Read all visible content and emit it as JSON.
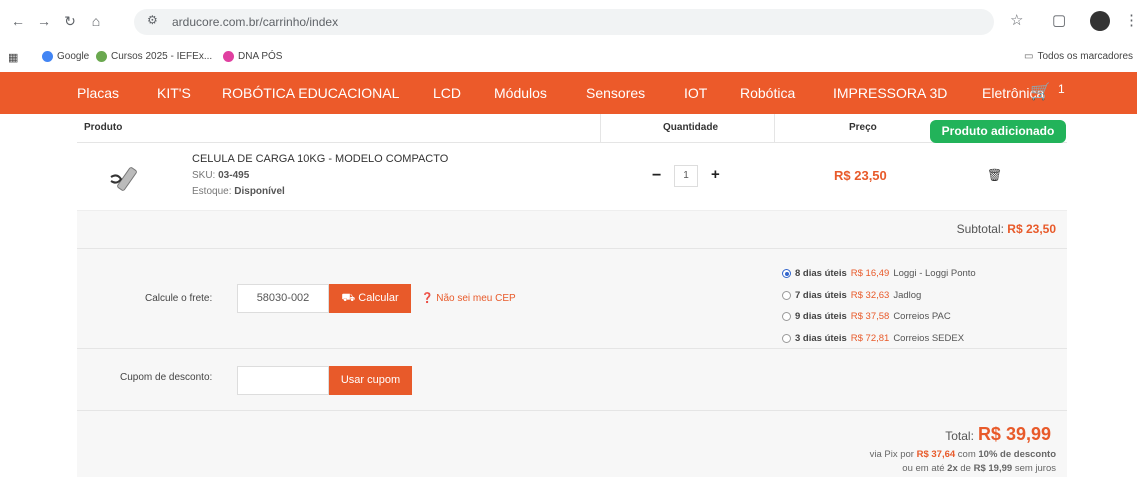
{
  "browser": {
    "url": "arducore.com.br/carrinho/index",
    "bookmarks": [
      "Google",
      "Cursos 2025 - IEFEx...",
      "DNA PÓS"
    ],
    "all_bookmarks": "Todos os marcadores"
  },
  "nav": {
    "items": [
      "Placas",
      "KIT'S",
      "ROBÓTICA EDUCACIONAL",
      "LCD",
      "Módulos",
      "Sensores",
      "IOT",
      "Robótica",
      "IMPRESSORA 3D",
      "Eletrônica"
    ],
    "cart_count": "1"
  },
  "table": {
    "col_product": "Produto",
    "col_qty": "Quantidade",
    "col_price": "Preço",
    "toast": "Produto adicionado"
  },
  "product": {
    "name": "CELULA DE CARGA 10KG - MODELO COMPACTO",
    "sku_label": "SKU:",
    "sku": "03-495",
    "stock_label": "Estoque:",
    "stock": "Disponível",
    "quantity": "1",
    "price": "R$ 23,50"
  },
  "subtotal": {
    "label": "Subtotal:",
    "value": "R$ 23,50"
  },
  "shipping": {
    "label": "Calcule o frete:",
    "cep": "58030-002",
    "calc_button": "Calcular",
    "no_cep": "Não sei meu CEP",
    "options": [
      {
        "days": "8 dias úteis",
        "price": "R$ 16,49",
        "carrier": "Loggi - Loggi Ponto",
        "selected": true
      },
      {
        "days": "7 dias úteis",
        "price": "R$ 32,63",
        "carrier": "Jadlog",
        "selected": false
      },
      {
        "days": "9 dias úteis",
        "price": "R$ 37,58",
        "carrier": "Correios PAC",
        "selected": false
      },
      {
        "days": "3 dias úteis",
        "price": "R$ 72,81",
        "carrier": "Correios SEDEX",
        "selected": false
      }
    ]
  },
  "coupon": {
    "label": "Cupom de desconto:",
    "button": "Usar cupom"
  },
  "total": {
    "label": "Total:",
    "value": "R$ 39,99",
    "pix_prefix": "via Pix por",
    "pix_value": "R$ 37,64",
    "pix_middle": "com",
    "pix_discount": "10% de desconto",
    "inst_prefix": "ou em até",
    "inst_count": "2x",
    "inst_middle": "de",
    "inst_value": "R$ 19,99",
    "inst_suffix": "sem juros"
  },
  "colors": {
    "brand": "#ec5a2a",
    "success": "#22b35a",
    "price": "#e85a2a"
  }
}
